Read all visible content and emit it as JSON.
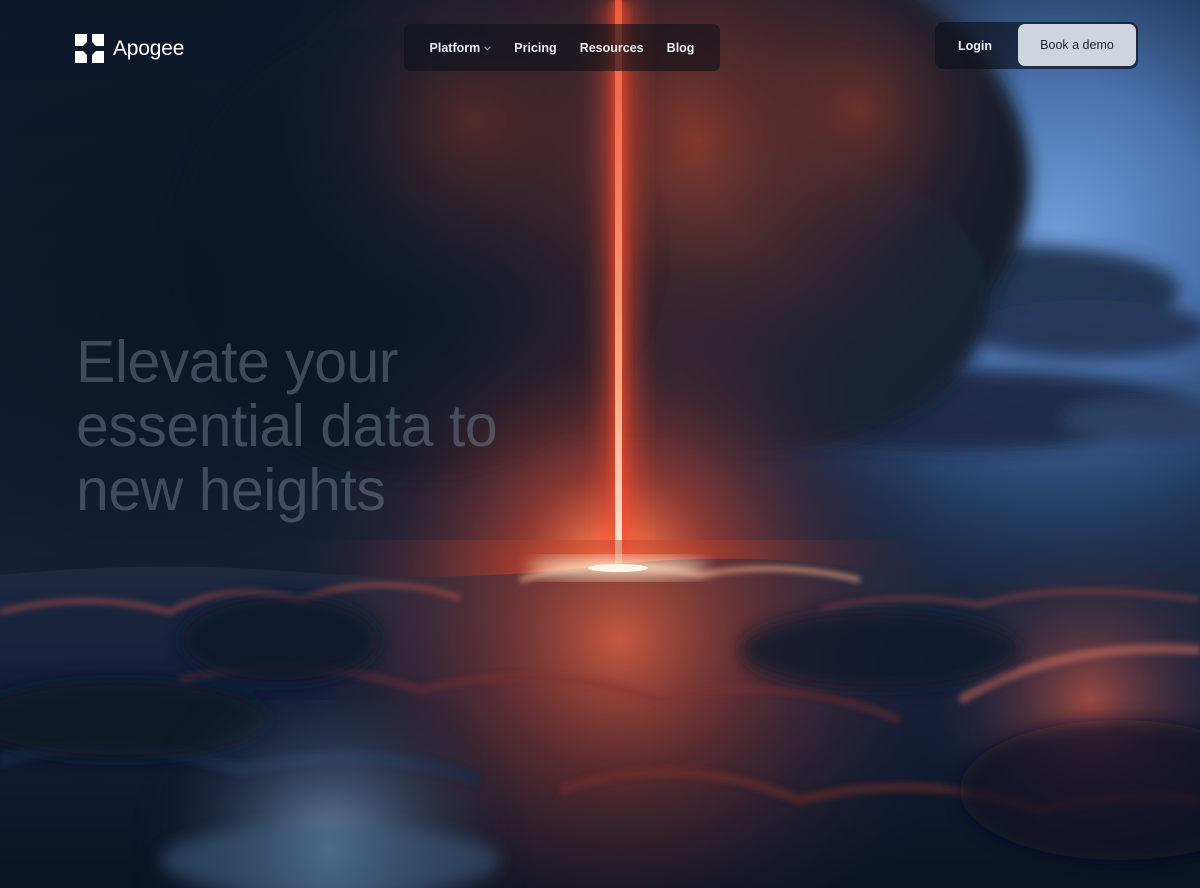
{
  "brand": {
    "name": "Apogee",
    "logo_icon": "apogee-logo-icon"
  },
  "nav": {
    "items": [
      {
        "label": "Platform",
        "has_dropdown": true,
        "icon": "chevron-down-icon"
      },
      {
        "label": "Pricing",
        "has_dropdown": false
      },
      {
        "label": "Resources",
        "has_dropdown": false
      },
      {
        "label": "Blog",
        "has_dropdown": false
      }
    ]
  },
  "actions": {
    "login_label": "Login",
    "demo_label": "Book a demo"
  },
  "hero": {
    "lines": [
      "Elevate your",
      "essential data to",
      "new heights"
    ]
  },
  "background": {
    "description_icon": "storm-sea-light-beam-image"
  },
  "colors": {
    "beam": "#ff5a3c",
    "demo_button": "#cfd5dc",
    "nav_background": "#0e121a"
  }
}
